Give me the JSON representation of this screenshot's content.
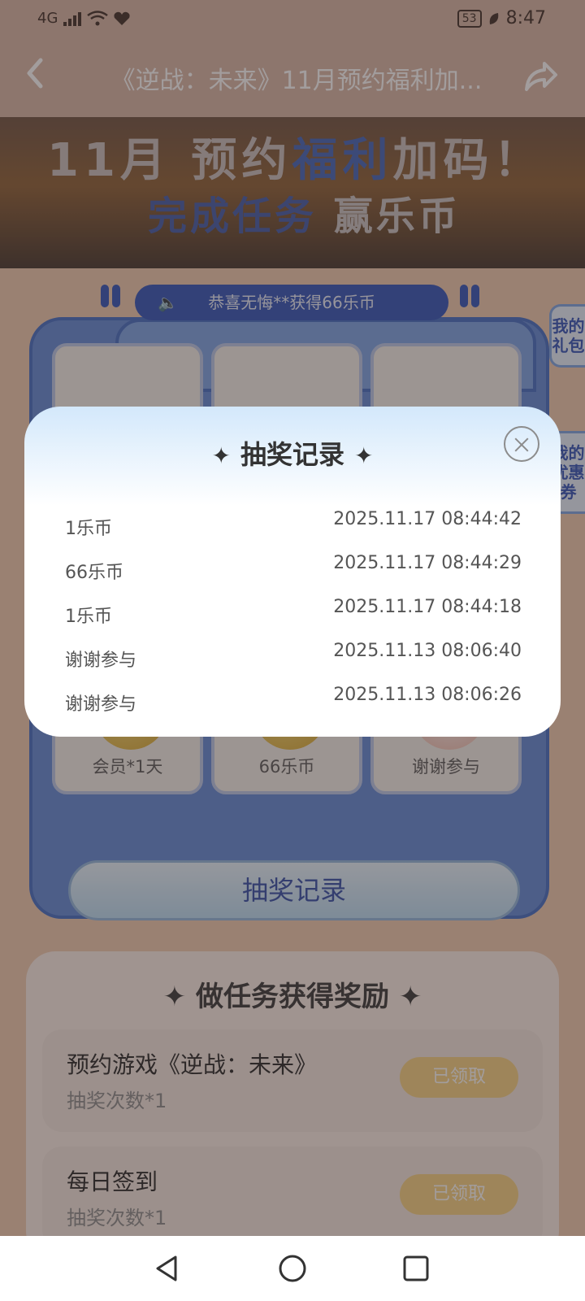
{
  "status_bar": {
    "network": "4G",
    "battery": "53",
    "time": "8:47"
  },
  "titlebar": {
    "back_icon": "chevron-left-icon",
    "title": "《逆战：未来》11月预约福利加...",
    "share_icon": "share-icon"
  },
  "banner": {
    "line1_a": "11月  预约",
    "line1_b": "福利",
    "line1_c": "加码！",
    "line2_a": "完成任务",
    "line2_b": "赢乐币"
  },
  "lottery": {
    "announcement": "恭喜无悔**获得66乐币",
    "prizes": [
      {
        "label": "会员*1天"
      },
      {
        "label": "66乐币"
      },
      {
        "label": "谢谢参与"
      }
    ],
    "record_button": "抽奖记录"
  },
  "side_tabs": {
    "gift": "我的礼包",
    "coupon": "我的优惠券"
  },
  "tasks": {
    "title": "✦ 做任务获得奖励 ✦",
    "items": [
      {
        "name": "预约游戏《逆战：未来》",
        "reward": "抽奖次数*1",
        "status": "已领取"
      },
      {
        "name": "每日签到",
        "reward": "抽奖次数*1",
        "status": "已领取"
      }
    ]
  },
  "modal": {
    "title": "抽奖记录",
    "close_icon": "close-icon",
    "records": [
      {
        "prize": "1乐币",
        "time": "2025.11.17 08:44:42"
      },
      {
        "prize": "66乐币",
        "time": "2025.11.17 08:44:29"
      },
      {
        "prize": "1乐币",
        "time": "2025.11.17 08:44:18"
      },
      {
        "prize": "谢谢参与",
        "time": "2025.11.13 08:06:40"
      },
      {
        "prize": "谢谢参与",
        "time": "2025.11.13 08:06:26"
      }
    ]
  },
  "navbar": {
    "back_icon": "nav-back-icon",
    "home_icon": "nav-home-icon",
    "recents_icon": "nav-recents-icon"
  }
}
